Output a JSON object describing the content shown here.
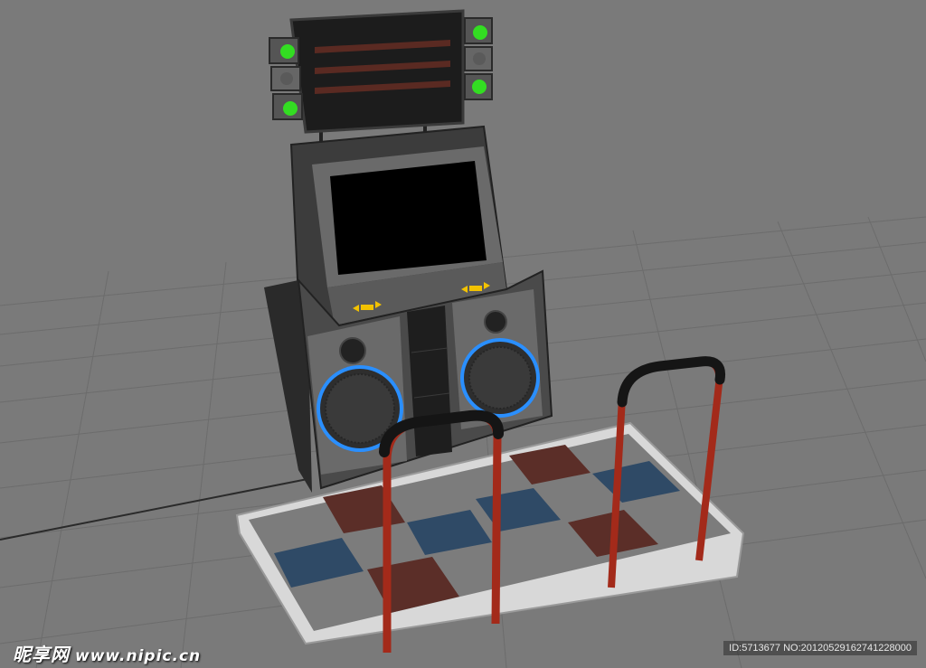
{
  "scene": {
    "subject": "dance-arcade-machine-3d-render",
    "colors": {
      "background": "#7a7a7a",
      "grid_line": "#6e6e6e",
      "cabinet": "#4a4a4a",
      "cabinet_dark": "#2e2e2e",
      "screen": "#000000",
      "marquee": "#1c1c1c",
      "marquee_stripe": "#5a2a22",
      "light_green": "#33dd22",
      "speaker_ring": "#2a8fff",
      "arrow_yellow": "#f2c200",
      "platform_edge": "#d8d8d8",
      "panel_gray": "#7c7c7c",
      "panel_red": "#5b2e28",
      "panel_blue": "#2f4a66",
      "rail_red": "#a32a1a",
      "rail_black": "#151515"
    }
  },
  "watermark": {
    "brand": "昵享网",
    "site": "www.nipic.cn",
    "id_text": "ID:5713677 NO:20120529162741228000"
  }
}
